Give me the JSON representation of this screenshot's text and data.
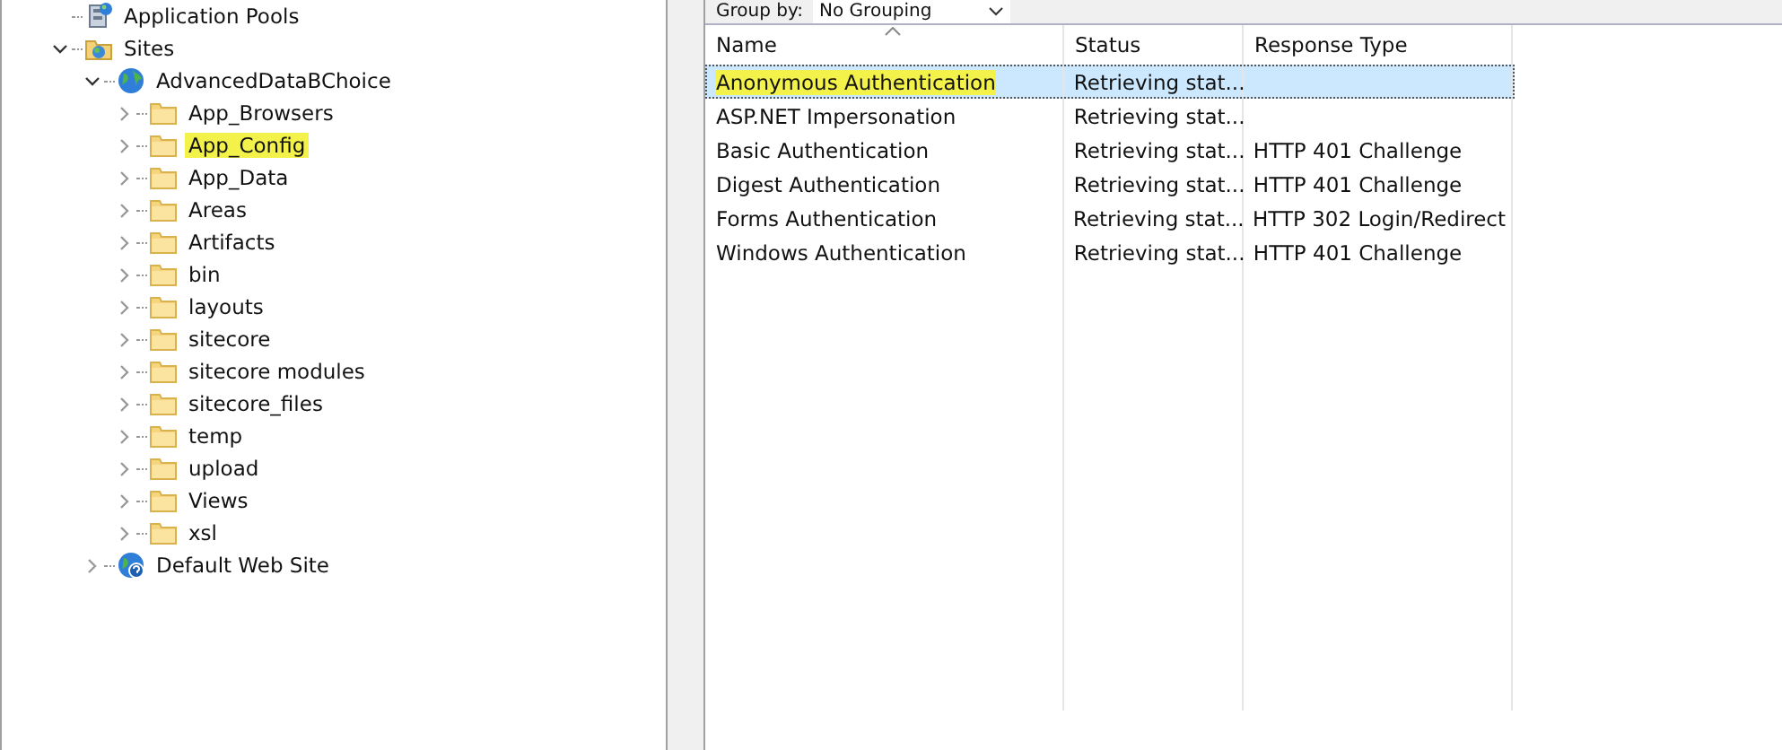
{
  "tree": [
    {
      "label": "Application Pools",
      "kind": "pools"
    },
    {
      "label": "Sites",
      "kind": "sites",
      "expanded": true,
      "children": [
        {
          "label": "AdvancedDataBChoice",
          "kind": "site",
          "expanded": true,
          "children": [
            {
              "label": "App_Browsers",
              "kind": "folder",
              "expanded": false,
              "highlighted": false
            },
            {
              "label": "App_Config",
              "kind": "folder",
              "expanded": false,
              "highlighted": true
            },
            {
              "label": "App_Data",
              "kind": "folder",
              "expanded": false,
              "highlighted": false
            },
            {
              "label": "Areas",
              "kind": "folder",
              "expanded": false,
              "highlighted": false
            },
            {
              "label": "Artifacts",
              "kind": "folder",
              "expanded": false,
              "highlighted": false
            },
            {
              "label": "bin",
              "kind": "folder",
              "expanded": false,
              "highlighted": false
            },
            {
              "label": "layouts",
              "kind": "folder",
              "expanded": false,
              "highlighted": false
            },
            {
              "label": "sitecore",
              "kind": "folder",
              "expanded": false,
              "highlighted": false
            },
            {
              "label": "sitecore modules",
              "kind": "folder",
              "expanded": false,
              "highlighted": false
            },
            {
              "label": "sitecore_files",
              "kind": "folder",
              "expanded": false,
              "highlighted": false
            },
            {
              "label": "temp",
              "kind": "folder",
              "expanded": false,
              "highlighted": false
            },
            {
              "label": "upload",
              "kind": "folder",
              "expanded": false,
              "highlighted": false
            },
            {
              "label": "Views",
              "kind": "folder",
              "expanded": false,
              "highlighted": false
            },
            {
              "label": "xsl",
              "kind": "folder",
              "expanded": false,
              "highlighted": false
            }
          ]
        },
        {
          "label": "Default Web Site",
          "kind": "site_default",
          "expanded": false
        }
      ]
    }
  ],
  "group_by": {
    "label": "Group by:",
    "value": "No Grouping"
  },
  "table": {
    "columns": [
      "Name",
      "Status",
      "Response Type"
    ],
    "rows": [
      {
        "cells": [
          "Anonymous Authentication",
          "Retrieving stat...",
          ""
        ],
        "selected": true,
        "highlighted": true
      },
      {
        "cells": [
          "ASP.NET Impersonation",
          "Retrieving stat...",
          ""
        ],
        "selected": false,
        "highlighted": false
      },
      {
        "cells": [
          "Basic Authentication",
          "Retrieving stat...",
          "HTTP 401 Challenge"
        ],
        "selected": false,
        "highlighted": false
      },
      {
        "cells": [
          "Digest Authentication",
          "Retrieving stat...",
          "HTTP 401 Challenge"
        ],
        "selected": false,
        "highlighted": false
      },
      {
        "cells": [
          "Forms Authentication",
          "Retrieving stat...",
          "HTTP 302 Login/Redirect"
        ],
        "selected": false,
        "highlighted": false
      },
      {
        "cells": [
          "Windows Authentication",
          "Retrieving stat...",
          "HTTP 401 Challenge"
        ],
        "selected": false,
        "highlighted": false
      }
    ]
  }
}
